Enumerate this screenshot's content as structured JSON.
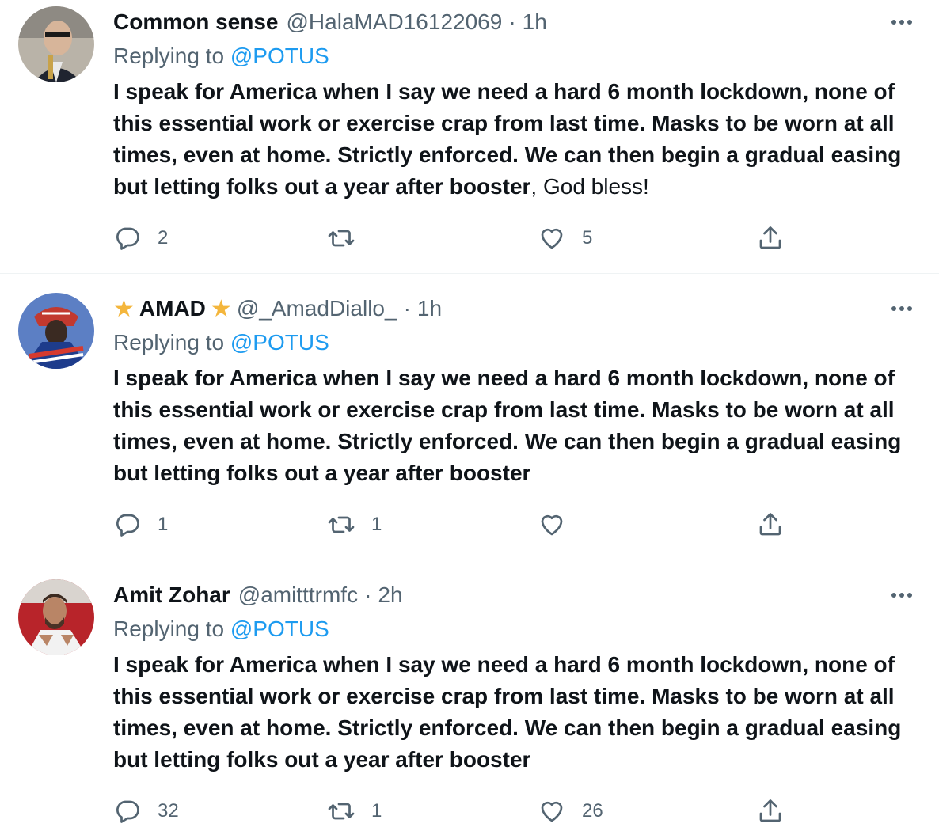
{
  "tweets": [
    {
      "name": "Common sense",
      "name_star": false,
      "handle": "@HalaMAD16122069",
      "separator": "·",
      "time": "1h",
      "replying_prefix": "Replying to",
      "replying_to": "@POTUS",
      "text_bold": "I speak for America when I say we need a hard 6 month lockdown, none of this essential work or exercise crap from last time. Masks to be worn at all times, even at home. Strictly enforced. We can then begin a gradual easing but letting folks out a year after booster",
      "text_normal": ", God bless!",
      "replies": "2",
      "retweets": "",
      "likes": "5"
    },
    {
      "name": "AMAD",
      "name_star": true,
      "star_glyph": "★",
      "handle": "@_AmadDiallo_",
      "separator": "·",
      "time": "1h",
      "replying_prefix": "Replying to",
      "replying_to": "@POTUS",
      "text_bold": "I speak for America when I say we need a hard 6 month lockdown, none of this essential work or exercise crap from last time. Masks to be worn at all times, even at home. Strictly enforced. We can then begin a gradual easing but letting folks out a year after booster",
      "text_normal": "",
      "replies": "1",
      "retweets": "1",
      "likes": ""
    },
    {
      "name": "Amit Zohar",
      "name_star": false,
      "handle": "@amitttrmfc",
      "separator": "·",
      "time": "2h",
      "replying_prefix": "Replying to",
      "replying_to": "@POTUS",
      "text_bold": "I speak for America when I say we need a hard 6 month lockdown, none of this essential work or exercise crap from last time. Masks to be worn at all times, even at home. Strictly enforced. We can then begin a gradual easing but letting folks out a year after booster",
      "text_normal": "",
      "replies": "32",
      "retweets": "1",
      "likes": "26"
    }
  ],
  "colors": {
    "text": "#0f1419",
    "secondary": "#536471",
    "link": "#1d9bf0",
    "star": "#f4b63c",
    "divider": "#eff3f4"
  },
  "icons": [
    "reply-icon",
    "retweet-icon",
    "like-icon",
    "share-icon",
    "more-options-icon"
  ]
}
